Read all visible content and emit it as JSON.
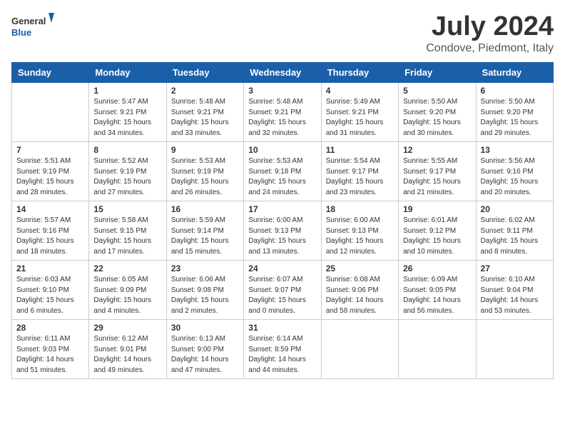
{
  "header": {
    "logo_general": "General",
    "logo_blue": "Blue",
    "month_year": "July 2024",
    "location": "Condove, Piedmont, Italy"
  },
  "weekdays": [
    "Sunday",
    "Monday",
    "Tuesday",
    "Wednesday",
    "Thursday",
    "Friday",
    "Saturday"
  ],
  "rows": [
    [
      {
        "day": "",
        "content": ""
      },
      {
        "day": "1",
        "content": "Sunrise: 5:47 AM\nSunset: 9:21 PM\nDaylight: 15 hours\nand 34 minutes."
      },
      {
        "day": "2",
        "content": "Sunrise: 5:48 AM\nSunset: 9:21 PM\nDaylight: 15 hours\nand 33 minutes."
      },
      {
        "day": "3",
        "content": "Sunrise: 5:48 AM\nSunset: 9:21 PM\nDaylight: 15 hours\nand 32 minutes."
      },
      {
        "day": "4",
        "content": "Sunrise: 5:49 AM\nSunset: 9:21 PM\nDaylight: 15 hours\nand 31 minutes."
      },
      {
        "day": "5",
        "content": "Sunrise: 5:50 AM\nSunset: 9:20 PM\nDaylight: 15 hours\nand 30 minutes."
      },
      {
        "day": "6",
        "content": "Sunrise: 5:50 AM\nSunset: 9:20 PM\nDaylight: 15 hours\nand 29 minutes."
      }
    ],
    [
      {
        "day": "7",
        "content": "Sunrise: 5:51 AM\nSunset: 9:19 PM\nDaylight: 15 hours\nand 28 minutes."
      },
      {
        "day": "8",
        "content": "Sunrise: 5:52 AM\nSunset: 9:19 PM\nDaylight: 15 hours\nand 27 minutes."
      },
      {
        "day": "9",
        "content": "Sunrise: 5:53 AM\nSunset: 9:19 PM\nDaylight: 15 hours\nand 26 minutes."
      },
      {
        "day": "10",
        "content": "Sunrise: 5:53 AM\nSunset: 9:18 PM\nDaylight: 15 hours\nand 24 minutes."
      },
      {
        "day": "11",
        "content": "Sunrise: 5:54 AM\nSunset: 9:17 PM\nDaylight: 15 hours\nand 23 minutes."
      },
      {
        "day": "12",
        "content": "Sunrise: 5:55 AM\nSunset: 9:17 PM\nDaylight: 15 hours\nand 21 minutes."
      },
      {
        "day": "13",
        "content": "Sunrise: 5:56 AM\nSunset: 9:16 PM\nDaylight: 15 hours\nand 20 minutes."
      }
    ],
    [
      {
        "day": "14",
        "content": "Sunrise: 5:57 AM\nSunset: 9:16 PM\nDaylight: 15 hours\nand 18 minutes."
      },
      {
        "day": "15",
        "content": "Sunrise: 5:58 AM\nSunset: 9:15 PM\nDaylight: 15 hours\nand 17 minutes."
      },
      {
        "day": "16",
        "content": "Sunrise: 5:59 AM\nSunset: 9:14 PM\nDaylight: 15 hours\nand 15 minutes."
      },
      {
        "day": "17",
        "content": "Sunrise: 6:00 AM\nSunset: 9:13 PM\nDaylight: 15 hours\nand 13 minutes."
      },
      {
        "day": "18",
        "content": "Sunrise: 6:00 AM\nSunset: 9:13 PM\nDaylight: 15 hours\nand 12 minutes."
      },
      {
        "day": "19",
        "content": "Sunrise: 6:01 AM\nSunset: 9:12 PM\nDaylight: 15 hours\nand 10 minutes."
      },
      {
        "day": "20",
        "content": "Sunrise: 6:02 AM\nSunset: 9:11 PM\nDaylight: 15 hours\nand 8 minutes."
      }
    ],
    [
      {
        "day": "21",
        "content": "Sunrise: 6:03 AM\nSunset: 9:10 PM\nDaylight: 15 hours\nand 6 minutes."
      },
      {
        "day": "22",
        "content": "Sunrise: 6:05 AM\nSunset: 9:09 PM\nDaylight: 15 hours\nand 4 minutes."
      },
      {
        "day": "23",
        "content": "Sunrise: 6:06 AM\nSunset: 9:08 PM\nDaylight: 15 hours\nand 2 minutes."
      },
      {
        "day": "24",
        "content": "Sunrise: 6:07 AM\nSunset: 9:07 PM\nDaylight: 15 hours\nand 0 minutes."
      },
      {
        "day": "25",
        "content": "Sunrise: 6:08 AM\nSunset: 9:06 PM\nDaylight: 14 hours\nand 58 minutes."
      },
      {
        "day": "26",
        "content": "Sunrise: 6:09 AM\nSunset: 9:05 PM\nDaylight: 14 hours\nand 56 minutes."
      },
      {
        "day": "27",
        "content": "Sunrise: 6:10 AM\nSunset: 9:04 PM\nDaylight: 14 hours\nand 53 minutes."
      }
    ],
    [
      {
        "day": "28",
        "content": "Sunrise: 6:11 AM\nSunset: 9:03 PM\nDaylight: 14 hours\nand 51 minutes."
      },
      {
        "day": "29",
        "content": "Sunrise: 6:12 AM\nSunset: 9:01 PM\nDaylight: 14 hours\nand 49 minutes."
      },
      {
        "day": "30",
        "content": "Sunrise: 6:13 AM\nSunset: 9:00 PM\nDaylight: 14 hours\nand 47 minutes."
      },
      {
        "day": "31",
        "content": "Sunrise: 6:14 AM\nSunset: 8:59 PM\nDaylight: 14 hours\nand 44 minutes."
      },
      {
        "day": "",
        "content": ""
      },
      {
        "day": "",
        "content": ""
      },
      {
        "day": "",
        "content": ""
      }
    ]
  ]
}
